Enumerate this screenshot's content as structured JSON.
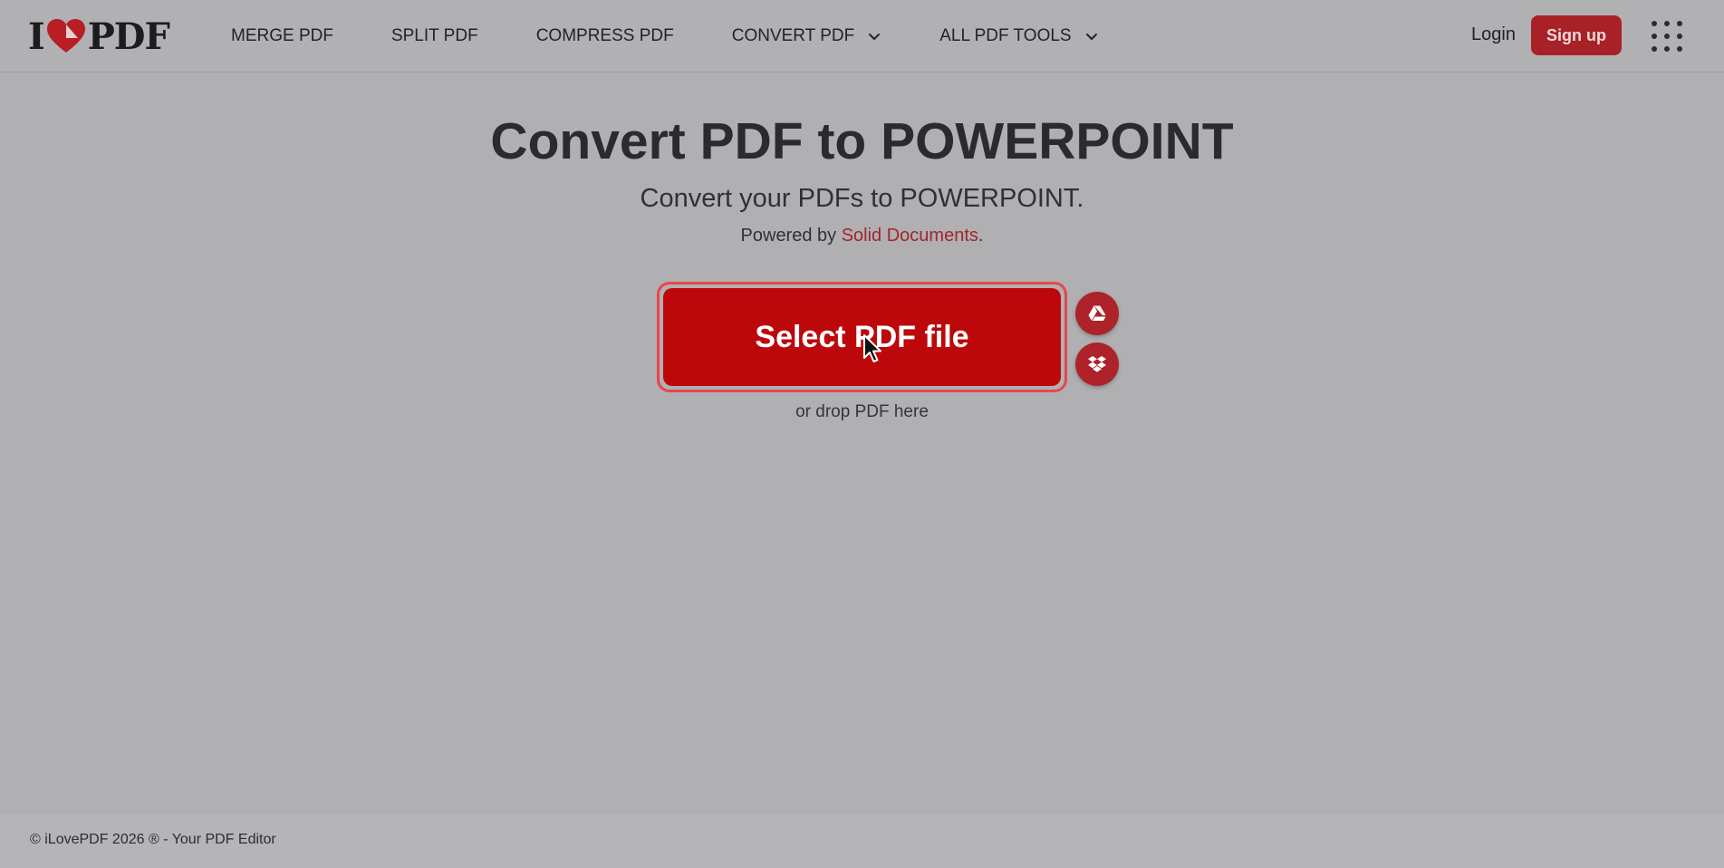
{
  "brand": {
    "logo_left": "I",
    "logo_right": "PDF",
    "accent": "#bc080b",
    "accent_dark": "#a82127"
  },
  "nav": {
    "items": [
      {
        "label": "MERGE PDF",
        "dropdown": false
      },
      {
        "label": "SPLIT PDF",
        "dropdown": false
      },
      {
        "label": "COMPRESS PDF",
        "dropdown": false
      },
      {
        "label": "CONVERT PDF",
        "dropdown": true
      },
      {
        "label": "ALL PDF TOOLS",
        "dropdown": true
      }
    ],
    "login": "Login",
    "signup": "Sign up",
    "apps_icon": "grid-apps-icon"
  },
  "main": {
    "title": "Convert PDF to POWERPOINT",
    "subtitle": "Convert your PDFs to POWERPOINT.",
    "powered_prefix": "Powered by ",
    "powered_link": "Solid Documents",
    "powered_suffix": ".",
    "select_button": "Select PDF file",
    "drop_hint": "or drop PDF here",
    "cloud_buttons": [
      "google-drive-icon",
      "dropbox-icon"
    ]
  },
  "footer": {
    "copyright": "© iLovePDF 2026 ® - Your PDF Editor"
  }
}
